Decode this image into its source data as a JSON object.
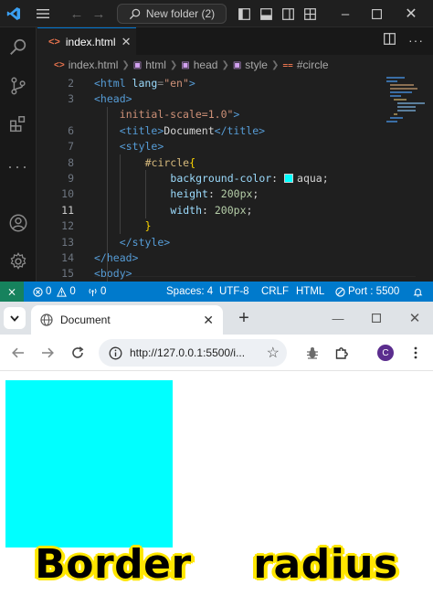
{
  "vscode": {
    "search_label": "New folder (2)",
    "tab_label": "index.html",
    "breadcrumb": [
      "index.html",
      "html",
      "head",
      "style",
      "#circle"
    ],
    "lines": [
      {
        "num": "2",
        "indent": 0,
        "tokens": [
          [
            "t-tag",
            "<html "
          ],
          [
            "t-attr",
            "lang"
          ],
          [
            "t-punct",
            "="
          ],
          [
            "t-str",
            "\"en\""
          ],
          [
            "t-tag",
            ">"
          ]
        ]
      },
      {
        "num": "3",
        "indent": 0,
        "tokens": [
          [
            "t-tag",
            "<head>"
          ]
        ]
      },
      {
        "num": "",
        "indent": 2,
        "tokens": [
          [
            "t-str",
            "initial-scale=1.0\""
          ],
          [
            "t-tag",
            ">"
          ]
        ]
      },
      {
        "num": "6",
        "indent": 2,
        "tokens": [
          [
            "t-tag",
            "<title>"
          ],
          [
            "t-text",
            "Document"
          ],
          [
            "t-tag",
            "</title>"
          ]
        ]
      },
      {
        "num": "7",
        "indent": 2,
        "tokens": [
          [
            "t-tag",
            "<style>"
          ]
        ]
      },
      {
        "num": "8",
        "indent": 4,
        "tokens": [
          [
            "t-sel",
            "#circle"
          ],
          [
            "bracket",
            "{"
          ]
        ]
      },
      {
        "num": "9",
        "indent": 6,
        "tokens": [
          [
            "t-prop",
            "background-color"
          ],
          [
            "t-val",
            ": "
          ],
          [
            "swatch",
            ""
          ],
          [
            "t-val",
            "aqua;"
          ]
        ]
      },
      {
        "num": "10",
        "indent": 6,
        "tokens": [
          [
            "t-prop",
            "height"
          ],
          [
            "t-val",
            ": "
          ],
          [
            "t-num",
            "200px"
          ],
          [
            "t-val",
            ";"
          ]
        ]
      },
      {
        "num": "11",
        "indent": 6,
        "tokens": [
          [
            "t-prop",
            "width"
          ],
          [
            "t-val",
            ": "
          ],
          [
            "t-num",
            "200px"
          ],
          [
            "t-val",
            ";"
          ]
        ]
      },
      {
        "num": "12",
        "indent": 4,
        "tokens": [
          [
            "bracket",
            "}"
          ]
        ]
      },
      {
        "num": "13",
        "indent": 2,
        "tokens": [
          [
            "t-tag",
            "</style>"
          ]
        ]
      },
      {
        "num": "14",
        "indent": 0,
        "tokens": [
          [
            "t-tag",
            "</head>"
          ]
        ]
      },
      {
        "num": "15",
        "indent": 0,
        "tokens": [
          [
            "t-tag",
            "<body>"
          ]
        ]
      }
    ],
    "active_line": "11",
    "status": {
      "problems_errors": "0",
      "problems_warnings": "0",
      "ports": "0",
      "spaces": "Spaces: 4",
      "encoding": "UTF-8",
      "eol": "CRLF",
      "language": "HTML",
      "port": "Port : 5500"
    }
  },
  "chrome": {
    "tab_title": "Document",
    "url": "http://127.0.0.1:5500/i...",
    "profile_initial": "C",
    "accent_color": "#00ffff"
  },
  "caption": {
    "word1": "Border",
    "word2": "radius"
  }
}
